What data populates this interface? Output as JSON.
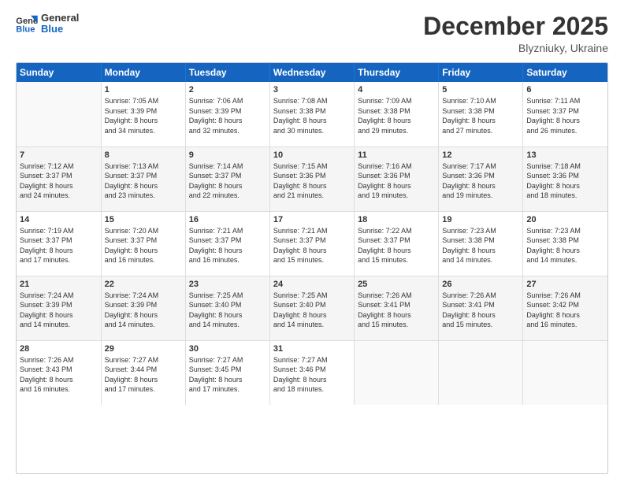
{
  "header": {
    "logo_text_general": "General",
    "logo_text_blue": "Blue",
    "month": "December 2025",
    "location": "Blyzniuky, Ukraine"
  },
  "days_of_week": [
    "Sunday",
    "Monday",
    "Tuesday",
    "Wednesday",
    "Thursday",
    "Friday",
    "Saturday"
  ],
  "weeks": [
    [
      {
        "day": "",
        "info": ""
      },
      {
        "day": "1",
        "info": "Sunrise: 7:05 AM\nSunset: 3:39 PM\nDaylight: 8 hours\nand 34 minutes."
      },
      {
        "day": "2",
        "info": "Sunrise: 7:06 AM\nSunset: 3:39 PM\nDaylight: 8 hours\nand 32 minutes."
      },
      {
        "day": "3",
        "info": "Sunrise: 7:08 AM\nSunset: 3:38 PM\nDaylight: 8 hours\nand 30 minutes."
      },
      {
        "day": "4",
        "info": "Sunrise: 7:09 AM\nSunset: 3:38 PM\nDaylight: 8 hours\nand 29 minutes."
      },
      {
        "day": "5",
        "info": "Sunrise: 7:10 AM\nSunset: 3:38 PM\nDaylight: 8 hours\nand 27 minutes."
      },
      {
        "day": "6",
        "info": "Sunrise: 7:11 AM\nSunset: 3:37 PM\nDaylight: 8 hours\nand 26 minutes."
      }
    ],
    [
      {
        "day": "7",
        "info": "Sunrise: 7:12 AM\nSunset: 3:37 PM\nDaylight: 8 hours\nand 24 minutes."
      },
      {
        "day": "8",
        "info": "Sunrise: 7:13 AM\nSunset: 3:37 PM\nDaylight: 8 hours\nand 23 minutes."
      },
      {
        "day": "9",
        "info": "Sunrise: 7:14 AM\nSunset: 3:37 PM\nDaylight: 8 hours\nand 22 minutes."
      },
      {
        "day": "10",
        "info": "Sunrise: 7:15 AM\nSunset: 3:36 PM\nDaylight: 8 hours\nand 21 minutes."
      },
      {
        "day": "11",
        "info": "Sunrise: 7:16 AM\nSunset: 3:36 PM\nDaylight: 8 hours\nand 19 minutes."
      },
      {
        "day": "12",
        "info": "Sunrise: 7:17 AM\nSunset: 3:36 PM\nDaylight: 8 hours\nand 19 minutes."
      },
      {
        "day": "13",
        "info": "Sunrise: 7:18 AM\nSunset: 3:36 PM\nDaylight: 8 hours\nand 18 minutes."
      }
    ],
    [
      {
        "day": "14",
        "info": "Sunrise: 7:19 AM\nSunset: 3:37 PM\nDaylight: 8 hours\nand 17 minutes."
      },
      {
        "day": "15",
        "info": "Sunrise: 7:20 AM\nSunset: 3:37 PM\nDaylight: 8 hours\nand 16 minutes."
      },
      {
        "day": "16",
        "info": "Sunrise: 7:21 AM\nSunset: 3:37 PM\nDaylight: 8 hours\nand 16 minutes."
      },
      {
        "day": "17",
        "info": "Sunrise: 7:21 AM\nSunset: 3:37 PM\nDaylight: 8 hours\nand 15 minutes."
      },
      {
        "day": "18",
        "info": "Sunrise: 7:22 AM\nSunset: 3:37 PM\nDaylight: 8 hours\nand 15 minutes."
      },
      {
        "day": "19",
        "info": "Sunrise: 7:23 AM\nSunset: 3:38 PM\nDaylight: 8 hours\nand 14 minutes."
      },
      {
        "day": "20",
        "info": "Sunrise: 7:23 AM\nSunset: 3:38 PM\nDaylight: 8 hours\nand 14 minutes."
      }
    ],
    [
      {
        "day": "21",
        "info": "Sunrise: 7:24 AM\nSunset: 3:39 PM\nDaylight: 8 hours\nand 14 minutes."
      },
      {
        "day": "22",
        "info": "Sunrise: 7:24 AM\nSunset: 3:39 PM\nDaylight: 8 hours\nand 14 minutes."
      },
      {
        "day": "23",
        "info": "Sunrise: 7:25 AM\nSunset: 3:40 PM\nDaylight: 8 hours\nand 14 minutes."
      },
      {
        "day": "24",
        "info": "Sunrise: 7:25 AM\nSunset: 3:40 PM\nDaylight: 8 hours\nand 14 minutes."
      },
      {
        "day": "25",
        "info": "Sunrise: 7:26 AM\nSunset: 3:41 PM\nDaylight: 8 hours\nand 15 minutes."
      },
      {
        "day": "26",
        "info": "Sunrise: 7:26 AM\nSunset: 3:41 PM\nDaylight: 8 hours\nand 15 minutes."
      },
      {
        "day": "27",
        "info": "Sunrise: 7:26 AM\nSunset: 3:42 PM\nDaylight: 8 hours\nand 16 minutes."
      }
    ],
    [
      {
        "day": "28",
        "info": "Sunrise: 7:26 AM\nSunset: 3:43 PM\nDaylight: 8 hours\nand 16 minutes."
      },
      {
        "day": "29",
        "info": "Sunrise: 7:27 AM\nSunset: 3:44 PM\nDaylight: 8 hours\nand 17 minutes."
      },
      {
        "day": "30",
        "info": "Sunrise: 7:27 AM\nSunset: 3:45 PM\nDaylight: 8 hours\nand 17 minutes."
      },
      {
        "day": "31",
        "info": "Sunrise: 7:27 AM\nSunset: 3:46 PM\nDaylight: 8 hours\nand 18 minutes."
      },
      {
        "day": "",
        "info": ""
      },
      {
        "day": "",
        "info": ""
      },
      {
        "day": "",
        "info": ""
      }
    ]
  ]
}
